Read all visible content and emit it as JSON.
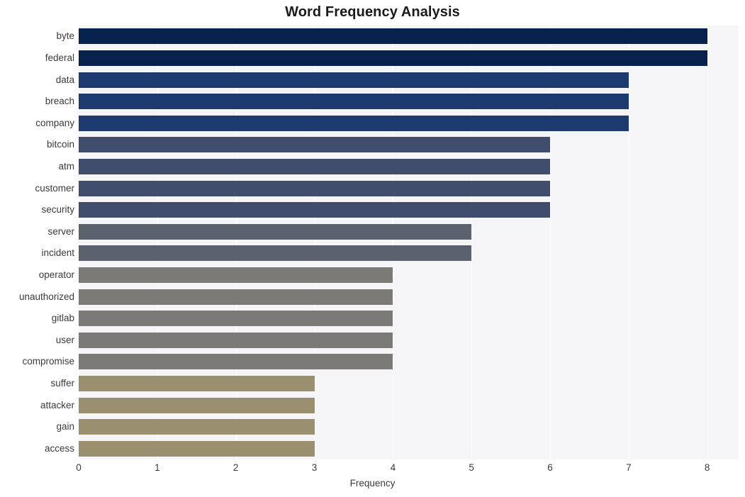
{
  "chart_data": {
    "type": "bar",
    "orientation": "horizontal",
    "title": "Word Frequency Analysis",
    "xlabel": "Frequency",
    "ylabel": "",
    "xlim": [
      0,
      8.4
    ],
    "ylim": [
      0,
      20
    ],
    "grid": true,
    "legend": null,
    "xticks": [
      "0",
      "1",
      "2",
      "3",
      "4",
      "5",
      "6",
      "7",
      "8"
    ],
    "xtick_values": [
      0,
      1,
      2,
      3,
      4,
      5,
      6,
      7,
      8
    ],
    "categories": [
      "byte",
      "federal",
      "data",
      "breach",
      "company",
      "bitcoin",
      "atm",
      "customer",
      "security",
      "server",
      "incident",
      "operator",
      "unauthorized",
      "gitlab",
      "user",
      "compromise",
      "suffer",
      "attacker",
      "gain",
      "access"
    ],
    "values": [
      8,
      8,
      7,
      7,
      7,
      6,
      6,
      6,
      6,
      5,
      5,
      4,
      4,
      4,
      4,
      4,
      3,
      3,
      3,
      3
    ],
    "bar_colors": [
      "#06214b",
      "#06214b",
      "#1d3a6e",
      "#1d3a6e",
      "#1d3a6e",
      "#414d6d",
      "#414d6d",
      "#414d6d",
      "#414d6d",
      "#5c626d",
      "#5c626d",
      "#7b7a77",
      "#7b7a77",
      "#7b7a77",
      "#7b7a77",
      "#7b7a77",
      "#9a9070",
      "#9a9070",
      "#9a9070",
      "#9a9070"
    ],
    "plot_background": "#f5f5f7",
    "gridline_color": "#ffffff",
    "text_color": "#3a3a3a",
    "title_color": "#1a1a1a"
  }
}
